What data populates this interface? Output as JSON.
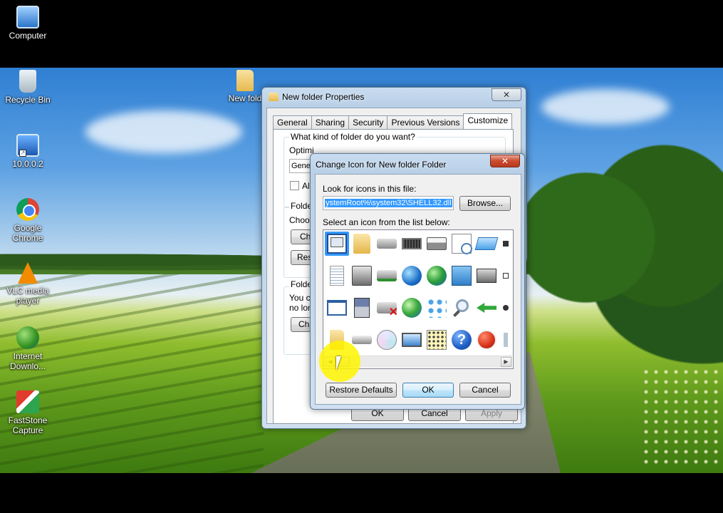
{
  "desktop": {
    "icons": [
      {
        "label": "Computer",
        "icon": "computer-icon"
      },
      {
        "label": "Recycle Bin",
        "icon": "recycle-bin-icon"
      },
      {
        "label": "10.0.0.2",
        "icon": "remote-desktop-icon"
      },
      {
        "label": "Google Chrome",
        "icon": "chrome-icon"
      },
      {
        "label": "VLC media player",
        "icon": "vlc-icon"
      },
      {
        "label": "Internet Downlo...",
        "icon": "internet-download-manager-icon"
      },
      {
        "label": "FastStone Capture",
        "icon": "faststone-capture-icon"
      },
      {
        "label": "New fold",
        "icon": "folder-icon"
      }
    ]
  },
  "properties_dialog": {
    "title": "New folder Properties",
    "close_label": "✕",
    "tabs": [
      "General",
      "Sharing",
      "Security",
      "Previous Versions",
      "Customize"
    ],
    "active_tab": "Customize",
    "question": "What kind of folder do you want?",
    "optimize_label": "Optimi",
    "optimize_value": "Gene",
    "also_apply_label": "Als",
    "folder_pictures_heading": "Folder",
    "choose_text": "Choos",
    "choose_button": "Ch",
    "restore_button": "Res",
    "folder_icons_heading": "Folder",
    "folder_icons_text_1": "You c",
    "folder_icons_text_2": "no lon",
    "change_icon_button": "Cha",
    "ok": "OK",
    "cancel": "Cancel",
    "apply": "Apply"
  },
  "change_icon_dialog": {
    "title": "Change Icon for New folder Folder",
    "close_label": "✕",
    "look_label": "Look for icons in this file:",
    "file_path": "ystemRoot%\\system32\\SHELL32.dll",
    "browse_button": "Browse...",
    "select_label": "Select an icon from the list below:",
    "restore_defaults_button": "Restore Defaults",
    "ok_button": "OK",
    "cancel_button": "Cancel",
    "help_glyph": "?",
    "icons": [
      "document-window-icon",
      "folder-icon",
      "drive-icon",
      "chip-icon",
      "printer-icon",
      "clock-document-icon",
      "network-window-icon",
      "partial-icon",
      "text-document-icon",
      "server-icon",
      "network-drive-icon",
      "globe-icon",
      "globe-computer-icon",
      "control-panel-icon",
      "cd-drive-icon",
      "shortcut-partial-icon",
      "blank-window-icon",
      "floppy-icon",
      "disconnected-drive-icon",
      "mouse-globe-icon",
      "network-computers-icon",
      "search-icon",
      "green-arrow-icon",
      "partial-icon-2",
      "folder-half-icon",
      "drive-small-icon",
      "cd-disc-icon",
      "monitor-icon",
      "calculator-grid-icon",
      "help-icon",
      "power-icon",
      "partial-icon-3"
    ]
  }
}
